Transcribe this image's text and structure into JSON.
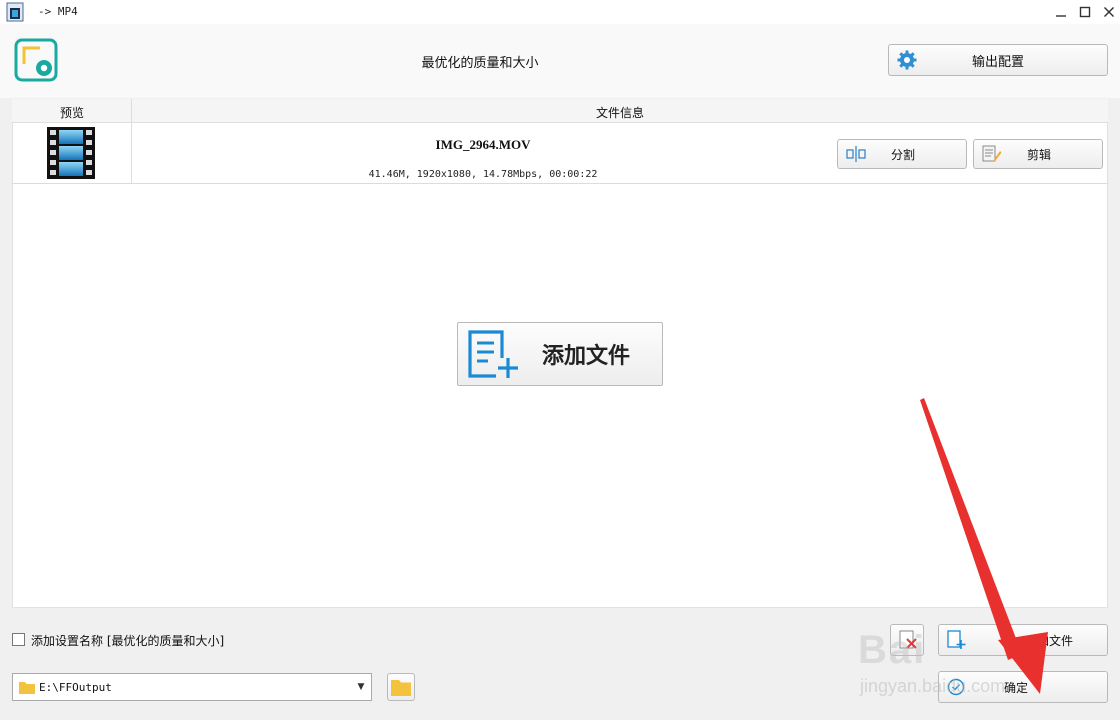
{
  "window": {
    "title": "-> MP4"
  },
  "header": {
    "profile_title": "最优化的质量和大小",
    "output_config_label": "输出配置"
  },
  "file_list": {
    "columns": [
      "预览",
      "文件信息"
    ],
    "rows": [
      {
        "name": "IMG_2964.MOV",
        "meta": "41.46M, 1920x1080, 14.78Mbps, 00:00:22",
        "split_label": "分割",
        "clip_label": "剪辑"
      }
    ]
  },
  "add_file_center_label": "添加文件",
  "bottom": {
    "checkbox_label": "添加设置名称 [最优化的质量和大小]",
    "checkbox_checked": false,
    "add_file_label": "加文件",
    "output_path": "E:\\FFOutput",
    "ok_label": "确定"
  },
  "watermark": {
    "line1": "Bai",
    "line2": "jingyan.baidu.com"
  },
  "colors": {
    "accent_teal": "#19a9a0",
    "accent_blue": "#1a8ad4",
    "annotation_red": "#e8312f"
  }
}
